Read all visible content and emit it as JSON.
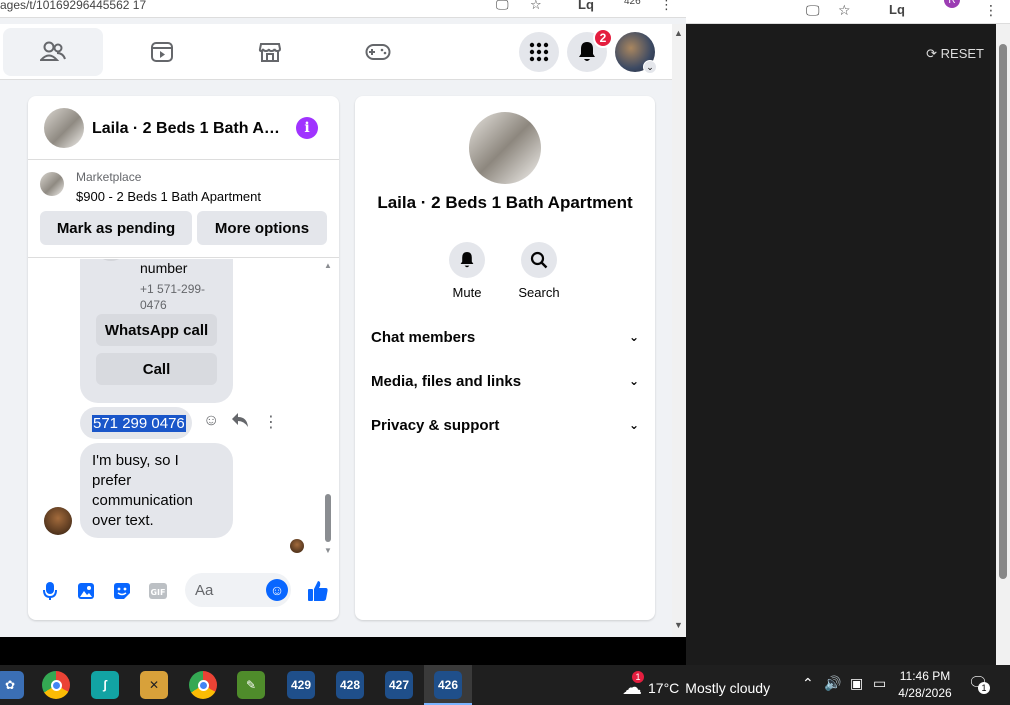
{
  "browser": {
    "url_fragment": "ages/t/10169296445562 17",
    "profile_count": "426"
  },
  "reset_label": "RESET",
  "nav": {
    "notification_count": "2"
  },
  "chat": {
    "title": "Laila · 2 Beds 1 Bath A…",
    "marketplace_label": "Marketplace",
    "listing": "$900 - 2 Beds 1 Bath Apartment",
    "mark_pending": "Mark as pending",
    "more_options": "More options",
    "contact_card": {
      "name_line": "number",
      "phone": "+1 571-299-0476",
      "whatsapp_label": "WhatsApp call",
      "call_label": "Call"
    },
    "selected_message": "571 299 0476",
    "text_message": "I'm busy, so I prefer communication over text.",
    "composer_placeholder": "Aa"
  },
  "info": {
    "title": "Laila · 2 Beds 1 Bath Apartment",
    "mute_label": "Mute",
    "search_label": "Search",
    "sections": [
      "Chat members",
      "Media, files and links",
      "Privacy & support"
    ]
  },
  "taskbar": {
    "app_badges": [
      "429",
      "428",
      "427",
      "426"
    ],
    "weather_alert": "1",
    "temperature": "17°C",
    "weather": "Mostly cloudy",
    "time": "11:46 PM",
    "date": "4/28/2026",
    "notification_count": "1"
  },
  "colors": {
    "accent": "#0866ff",
    "info_icon": "#a033ff",
    "badge": "#e41e3f",
    "selection": "#1a56c9"
  }
}
